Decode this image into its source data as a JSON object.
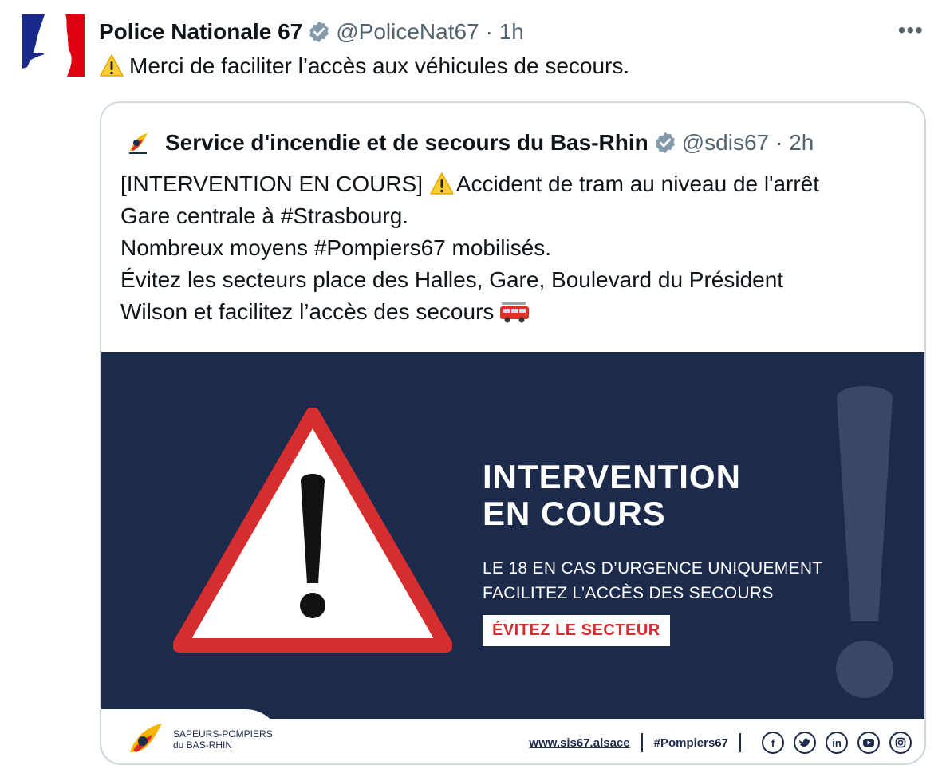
{
  "tweet": {
    "author_name": "Police Nationale 67",
    "handle": "@PoliceNat67",
    "time": "· 1h",
    "more_label": "•••",
    "text": "Merci de faciliter l’accès aux véhicules de secours."
  },
  "quoted": {
    "author_name": "Service d'incendie et de secours du Bas-Rhin",
    "handle": "@sdis67",
    "time": "· 2h",
    "lines": [
      {
        "before": "[INTERVENTION EN COURS] ",
        "after": "Accident de tram au niveau de l'arrêt"
      },
      {
        "text": "Gare centrale à #Strasbourg."
      },
      {
        "text": "Nombreux moyens #Pompiers67 mobilisés."
      },
      {
        "text": "Évitez les secteurs place des Halles, Gare, Boulevard du Président"
      },
      {
        "text": "Wilson et facilitez l’accès des secours"
      }
    ],
    "media": {
      "title_line1": "INTERVENTION",
      "title_line2": "EN COURS",
      "sub_line1": "LE 18 EN CAS D’URGENCE UNIQUEMENT",
      "sub_line2": "FACILITEZ L’ACCÈS DES SECOURS",
      "button": "ÉVITEZ LE SECTEUR",
      "footer_logo_line1": "SAPEURS-POMPIERS",
      "footer_logo_line2": "du BAS-RHIN",
      "website": "www.sis67.alsace",
      "hashtag": "#Pompiers67",
      "social": [
        "f",
        "t",
        "in",
        "yt",
        "ig"
      ]
    }
  },
  "colors": {
    "media_bg": "#1c2a4b",
    "accent_red": "#d62d2f",
    "verified": "#829aab",
    "muted": "#536471"
  }
}
